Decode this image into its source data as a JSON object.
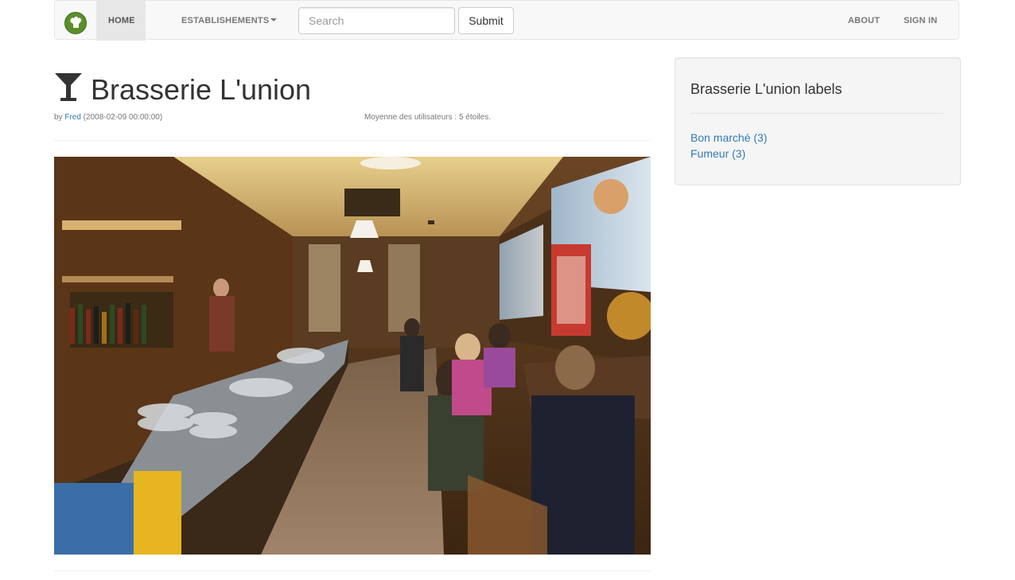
{
  "navbar": {
    "home": "HOME",
    "establishments": "ESTABLISHEMENTS",
    "search_placeholder": "Search",
    "submit": "Submit",
    "about": "ABOUT",
    "sign_in": "SIGN IN"
  },
  "establishment": {
    "title": "Brasserie L'union",
    "by_prefix": "by ",
    "author": "Fred",
    "date": " (2008-02-09 00:00:00)",
    "rating_text": "Moyenne des utilisateurs : 5 étoiles.",
    "category_icon": "cocktail-glass-icon"
  },
  "sidebar": {
    "title": "Brasserie L'union labels",
    "labels": [
      {
        "text": "Bon marché (3)"
      },
      {
        "text": "Fumeur (3)"
      }
    ]
  },
  "colors": {
    "link": "#337ab7",
    "brand_green": "#5a8f2a",
    "navbar_bg": "#f8f8f8",
    "active_bg": "#e7e7e7"
  }
}
